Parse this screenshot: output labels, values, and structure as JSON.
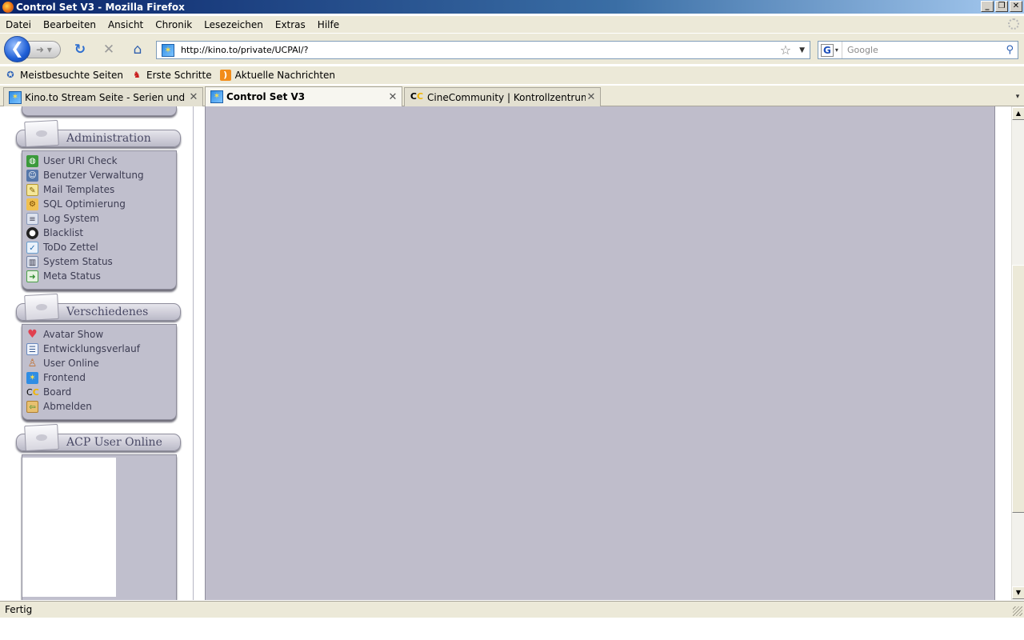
{
  "window": {
    "title": "Control Set V3 - Mozilla Firefox",
    "buttons": {
      "minimize": "_",
      "maximize": "❐",
      "close": "✕"
    }
  },
  "menu": [
    "Datei",
    "Bearbeiten",
    "Ansicht",
    "Chronik",
    "Lesezeichen",
    "Extras",
    "Hilfe"
  ],
  "nav": {
    "url": "http://kino.to/private/UCPAI/?",
    "search_placeholder": "Google",
    "icons": [
      "back-arrow-icon",
      "forward-arrow-icon",
      "reload-icon",
      "stop-icon",
      "home-icon",
      "star-icon",
      "search-magnifier-icon"
    ]
  },
  "bookmarks": [
    {
      "label": "Meistbesuchte Seiten",
      "icon": "bookmark-star-icon"
    },
    {
      "label": "Erste Schritte",
      "icon": "firefox-icon"
    },
    {
      "label": "Aktuelle Nachrichten",
      "icon": "rss-icon"
    }
  ],
  "tabs": [
    {
      "label": "Kino.to Stream Seite - Serien und Movi...",
      "active": false
    },
    {
      "label": "Control Set V3",
      "active": true
    },
    {
      "label": "CineCommunity | Kontrollzentrum von P...",
      "active": false
    }
  ],
  "sidebar": {
    "administration": {
      "title": "Administration",
      "items": [
        {
          "label": "User URI Check",
          "icon": "globe-icon",
          "color": "#3b9a3b"
        },
        {
          "label": "Benutzer Verwaltung",
          "icon": "users-icon",
          "color": "#5577aa"
        },
        {
          "label": "Mail Templates",
          "icon": "mail-template-icon",
          "color": "#d8c44a"
        },
        {
          "label": "SQL Optimierung",
          "icon": "database-icon",
          "color": "#e0a020"
        },
        {
          "label": "Log System",
          "icon": "log-icon",
          "color": "#8899bb"
        },
        {
          "label": "Blacklist",
          "icon": "bomb-icon",
          "color": "#222222"
        },
        {
          "label": "ToDo Zettel",
          "icon": "note-icon",
          "color": "#6aa0d0"
        },
        {
          "label": "System Status",
          "icon": "status-chart-icon",
          "color": "#7788aa"
        },
        {
          "label": "Meta Status",
          "icon": "meta-arrow-icon",
          "color": "#4aa04a"
        }
      ]
    },
    "verschiedenes": {
      "title": "Verschiedenes",
      "items": [
        {
          "label": "Avatar Show",
          "icon": "heart-icon",
          "color": "#e04050"
        },
        {
          "label": "Entwicklungsverlauf",
          "icon": "document-icon",
          "color": "#6a8ac0"
        },
        {
          "label": "User Online",
          "icon": "user-online-icon",
          "color": "#c07030"
        },
        {
          "label": "Frontend",
          "icon": "kino-logo-icon",
          "color": "#2f8de4"
        },
        {
          "label": "Board",
          "icon": "cinecommunity-logo-icon",
          "color": "#f0b400"
        },
        {
          "label": "Abmelden",
          "icon": "logout-door-icon",
          "color": "#b08030"
        }
      ]
    },
    "acp_online": {
      "title": "ACP User Online"
    }
  },
  "status": {
    "text": "Fertig"
  },
  "colors": {
    "panel_bg": "#c0bfcd",
    "main_bg": "#bfbdcb",
    "chrome": "#ece9d8"
  }
}
